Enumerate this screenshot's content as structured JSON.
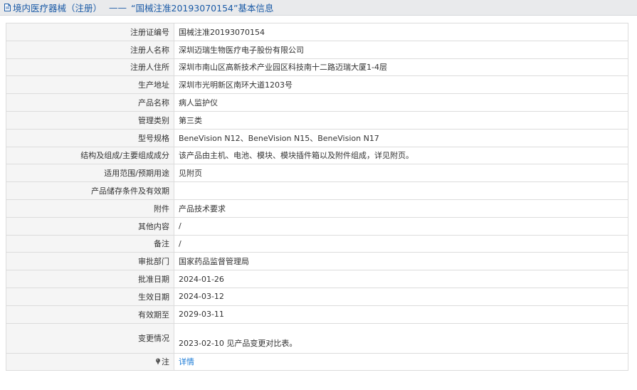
{
  "header": {
    "category": "境内医疗器械（注册）",
    "separator": "——",
    "title": "“国械注准20193070154”基本信息"
  },
  "rows": [
    {
      "label": "注册证编号",
      "value": "国械注准20193070154"
    },
    {
      "label": "注册人名称",
      "value": "深圳迈瑞生物医疗电子股份有限公司"
    },
    {
      "label": "注册人住所",
      "value": "深圳市南山区高新技术产业园区科技南十二路迈瑞大厦1-4层"
    },
    {
      "label": "生产地址",
      "value": "深圳市光明新区南环大道1203号"
    },
    {
      "label": "产品名称",
      "value": "病人监护仪"
    },
    {
      "label": "管理类别",
      "value": "第三类"
    },
    {
      "label": "型号规格",
      "value": "BeneVision N12、BeneVision N15、BeneVision N17"
    },
    {
      "label": "结构及组成/主要组成成分",
      "value": "该产品由主机、电池、模块、模块插件箱以及附件组成，详见附页。"
    },
    {
      "label": "适用范围/预期用途",
      "value": "见附页"
    },
    {
      "label": "产品储存条件及有效期",
      "value": ""
    },
    {
      "label": "附件",
      "value": "产品技术要求"
    },
    {
      "label": "其他内容",
      "value": "/"
    },
    {
      "label": "备注",
      "value": "/"
    },
    {
      "label": "审批部门",
      "value": "国家药品监督管理局"
    },
    {
      "label": "批准日期",
      "value": "2024-01-26"
    },
    {
      "label": "生效日期",
      "value": "2024-03-12"
    },
    {
      "label": "有效期至",
      "value": "2029-03-11"
    },
    {
      "label": "变更情况",
      "value": "2023-02-10 见产品变更对比表。"
    },
    {
      "label": "注",
      "value": "详情"
    }
  ],
  "icons": {
    "header_icon": "document-icon",
    "note_icon": "pin-icon"
  }
}
